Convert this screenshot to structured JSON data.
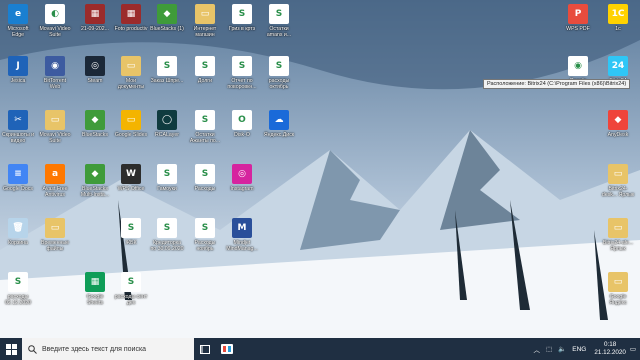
{
  "desktop": {
    "icons": [
      {
        "label": "Microsoft Edge",
        "color": "#1a7fd0",
        "glyph": "e"
      },
      {
        "label": "Movavi Video Suite",
        "color": "#ffffff",
        "glyph": "◐"
      },
      {
        "label": "21-09-202...",
        "color": "#9b2b2b",
        "glyph": "▦"
      },
      {
        "label": "Foto productiv",
        "color": "#9b2b2b",
        "glyph": "▦"
      },
      {
        "label": "BlueStacks (1)",
        "color": "#3f9b3a",
        "glyph": "◆"
      },
      {
        "label": "Интернет магазин",
        "color": "#e8c468",
        "glyph": "▭"
      },
      {
        "label": "Гриз в кртз",
        "color": "#ffffff",
        "glyph": "S"
      },
      {
        "label": "Остатки amans и...",
        "color": "#ffffff",
        "glyph": "S"
      },
      {
        "label": "Jesica",
        "color": "#1f63b8",
        "glyph": "J"
      },
      {
        "label": "BitTorrent Web",
        "color": "#3d5ba0",
        "glyph": "◉"
      },
      {
        "label": "Steam",
        "color": "#1b2838",
        "glyph": "◎"
      },
      {
        "label": "Мои документы",
        "color": "#e8c468",
        "glyph": "▭"
      },
      {
        "label": "Заказ Шпре...",
        "color": "#ffffff",
        "glyph": "S"
      },
      {
        "label": "Долги",
        "color": "#ffffff",
        "glyph": "S"
      },
      {
        "label": "Отчет по поворовкн...",
        "color": "#ffffff",
        "glyph": "S"
      },
      {
        "label": "расходы октябрь",
        "color": "#ffffff",
        "glyph": "S"
      },
      {
        "label": "Скриншоты и видео",
        "color": "#1f63b8",
        "glyph": "✂"
      },
      {
        "label": "Movavi Video Suite",
        "color": "#e8c468",
        "glyph": "▭"
      },
      {
        "label": "BlueStacks",
        "color": "#3f9b3a",
        "glyph": "◆"
      },
      {
        "label": "Google Slides",
        "color": "#f4b400",
        "glyph": "▭"
      },
      {
        "label": "RCALayer",
        "color": "#0f3b3f",
        "glyph": "◯"
      },
      {
        "label": "Остатки Ажанты по...",
        "color": "#ffffff",
        "glyph": "S"
      },
      {
        "label": "Disk-O",
        "color": "#ffffff",
        "glyph": "O"
      },
      {
        "label": "Яндекс.Диск",
        "color": "#1a6ad9",
        "glyph": "☁"
      },
      {
        "label": "Google Docs",
        "color": "#4285f4",
        "glyph": "≡"
      },
      {
        "label": "Avast Free Antivirus",
        "color": "#ff7800",
        "glyph": "a"
      },
      {
        "label": "BlueStacks Multi-Insta...",
        "color": "#3f9b3a",
        "glyph": "◆"
      },
      {
        "label": "WPS Office",
        "color": "#2c2c2c",
        "glyph": "W"
      },
      {
        "label": "Гамоуки",
        "color": "#ffffff",
        "glyph": "S"
      },
      {
        "label": "Расходы",
        "color": "#ffffff",
        "glyph": "S"
      },
      {
        "label": "Instagram",
        "color": "#d6249f",
        "glyph": "◎"
      },
      {
        "label": "Корзина",
        "color": "#b7d4ea",
        "glyph": "🗑"
      },
      {
        "label": "Временные файлы",
        "color": "#e8c468",
        "glyph": "▭"
      },
      {
        "label": "ЖБК",
        "color": "#ffffff",
        "glyph": "S"
      },
      {
        "label": "Кредиторка по 30.09.2020",
        "color": "#ffffff",
        "glyph": "S"
      },
      {
        "label": "Расходы ноябрь",
        "color": "#ffffff",
        "glyph": "S"
      },
      {
        "label": "Mindjet MindManag...",
        "color": "#2a4f9a",
        "glyph": "M"
      },
      {
        "label": "расходы 02.12.2020",
        "color": "#ffffff",
        "glyph": "S"
      },
      {
        "label": "Google Sheets",
        "color": "#0f9d58",
        "glyph": "▦"
      },
      {
        "label": "расходы сент дек",
        "color": "#ffffff",
        "glyph": "S"
      },
      {
        "label": "WPS PDF",
        "color": "#e84c3d",
        "glyph": "P"
      },
      {
        "label": "1c",
        "color": "#ffd200",
        "glyph": "1С"
      },
      {
        "label": "Google Chrome",
        "color": "#ffffff",
        "glyph": "◉"
      },
      {
        "label": "Bitrix24",
        "color": "#2fc6f6",
        "glyph": "24"
      },
      {
        "label": "AnyDesk",
        "color": "#ef443b",
        "glyph": "◆"
      },
      {
        "label": "Bitrix24-desk... Ярлык",
        "color": "#e8c468",
        "glyph": "▭"
      },
      {
        "label": "Bitrix24-ale... Ярлык",
        "color": "#e8c468",
        "glyph": "▭"
      },
      {
        "label": "Google Яндекс",
        "color": "#e8c468",
        "glyph": "▭"
      }
    ],
    "tooltip": "Расположение: Bitrix24 (C:\\Program Files (x86)\\Bitrix24)"
  },
  "taskbar": {
    "search_placeholder": "Введите здесь текст для поиска",
    "lang": "ENG",
    "time": "0:18",
    "date": "21.12.2020"
  }
}
